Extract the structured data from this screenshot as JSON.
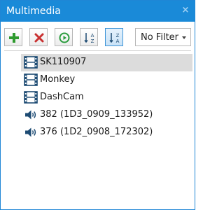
{
  "window": {
    "title": "Multimedia",
    "close_glyph": "×"
  },
  "toolbar": {
    "buttons": [
      {
        "name": "add-icon",
        "color": "#2e9a2e"
      },
      {
        "name": "delete-icon",
        "color": "#c93030"
      },
      {
        "name": "play-icon",
        "color": "#2a9c3d"
      },
      {
        "name": "sort-ascending-icon",
        "letters_top": "A",
        "letters_bottom": "Z"
      },
      {
        "name": "sort-descending-icon",
        "letters_top": "Z",
        "letters_bottom": "A",
        "active": true
      }
    ],
    "filter": {
      "selected": "No Filter"
    }
  },
  "items": [
    {
      "type": "video",
      "icon": "film-icon",
      "label": "SK110907",
      "selected": true
    },
    {
      "type": "video",
      "icon": "film-icon",
      "label": "Monkey"
    },
    {
      "type": "video",
      "icon": "film-icon",
      "label": "DashCam"
    },
    {
      "type": "audio",
      "icon": "speaker-icon",
      "label": "382 (1D3_0909_133952)"
    },
    {
      "type": "audio",
      "icon": "speaker-icon",
      "label": "376 (1D2_0908_172302)"
    }
  ],
  "colors": {
    "accent": "#1a8ad8",
    "selection": "#dcdcdc",
    "icon_dark": "#1d4b73"
  }
}
